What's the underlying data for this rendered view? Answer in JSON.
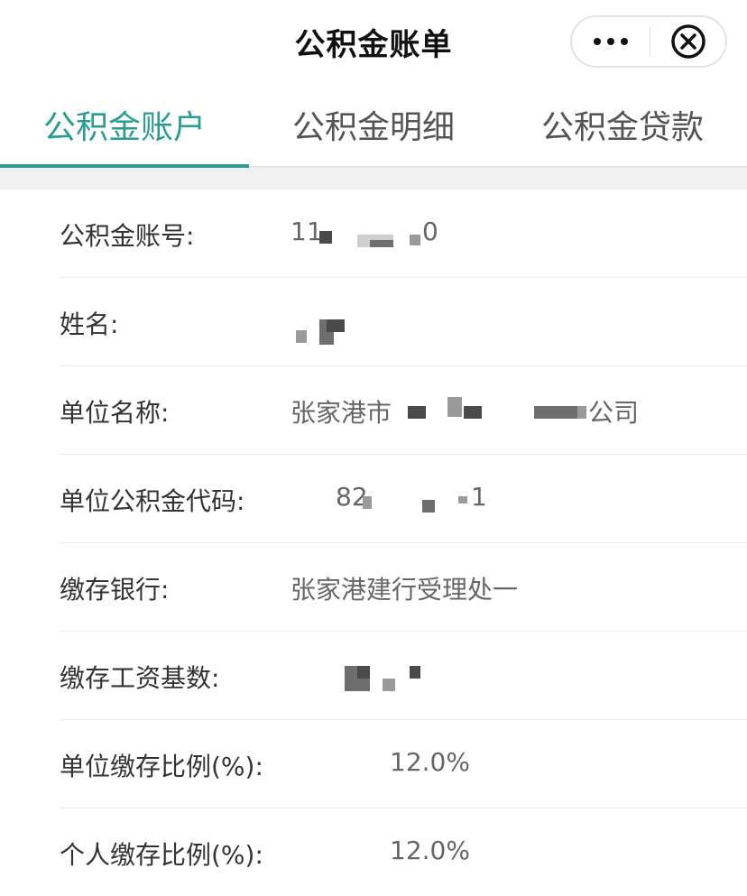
{
  "header": {
    "title": "公积金账单",
    "more_icon": "more-dots-icon",
    "close_icon": "close-circle-icon"
  },
  "tabs": [
    {
      "label": "公积金账户",
      "active": true
    },
    {
      "label": "公积金明细",
      "active": false
    },
    {
      "label": "公积金贷款",
      "active": false
    }
  ],
  "colors": {
    "accent": "#2a9d92",
    "separator": "#f1f1f1"
  },
  "account": {
    "rows": [
      {
        "label": "公积金账号:",
        "value_prefix": "11",
        "value_suffix": "0"
      },
      {
        "label": "姓名:",
        "value_prefix": "",
        "value_suffix": ""
      },
      {
        "label": "单位名称:",
        "value_prefix": "张家港市",
        "value_suffix": "公司"
      },
      {
        "label": "单位公积金代码:",
        "value_prefix": "82",
        "value_suffix": "1"
      },
      {
        "label": "缴存银行:",
        "value": "张家港建行受理处一"
      },
      {
        "label": "缴存工资基数:",
        "value": ""
      },
      {
        "label": "单位缴存比例(%):",
        "value": "12.0%"
      },
      {
        "label": "个人缴存比例(%):",
        "value": "12.0%"
      }
    ]
  }
}
